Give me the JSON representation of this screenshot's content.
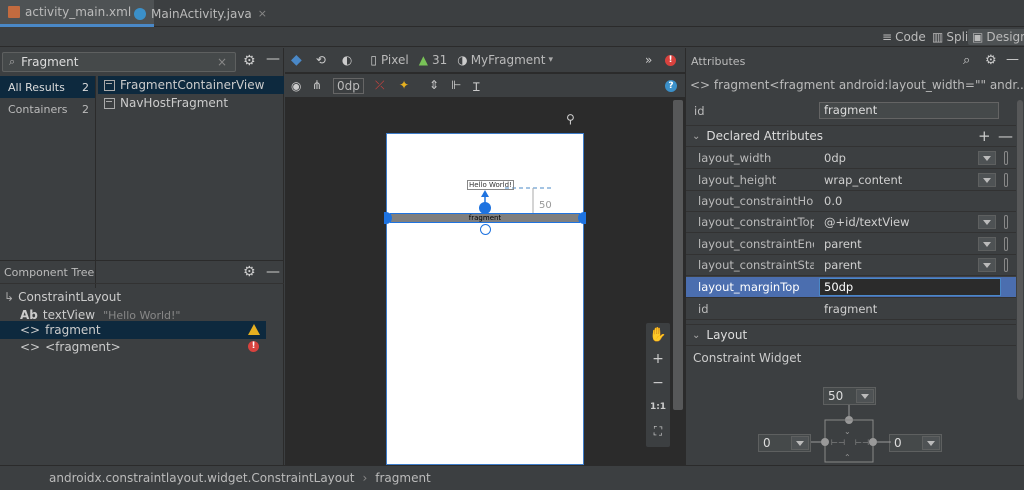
{
  "tabs": [
    {
      "label": "activity_main.xml",
      "close": "×"
    },
    {
      "label": "MainActivity.java",
      "close": "×"
    }
  ],
  "view_modes": {
    "code": "Code",
    "split": "Split",
    "design": "Design"
  },
  "palette": {
    "search_value": "Fragment",
    "categories": [
      {
        "label": "All Results",
        "count": "2"
      },
      {
        "label": "Containers",
        "count": "2"
      }
    ],
    "items": [
      "FragmentContainerView",
      "NavHostFragment"
    ]
  },
  "component_tree": {
    "title": "Component Tree",
    "rows": [
      {
        "label": "ConstraintLayout",
        "prefix": "",
        "hint": ""
      },
      {
        "label": "textView",
        "prefix": "Ab",
        "hint": "\"Hello World!\""
      },
      {
        "label": "fragment",
        "prefix": "<>",
        "hint": ""
      },
      {
        "label": "<fragment>",
        "prefix": "<>",
        "hint": ""
      }
    ]
  },
  "design_toolbar": {
    "device": "Pixel",
    "api": "31",
    "theme": "MyFragment",
    "margin": "0dp",
    "more": "»"
  },
  "canvas": {
    "textview_label": "Hello World!",
    "fragment_label": "fragment",
    "margin_label": "50"
  },
  "zoom_tools": {
    "plus": "+",
    "minus": "−",
    "ratio": "1:1"
  },
  "attributes": {
    "title": "Attributes",
    "tag_line": "<> fragment<fragment        android:layout_width=\"\"        andr...",
    "id_label": "id",
    "id_value": "fragment",
    "declared_header": "Declared Attributes",
    "rows": [
      {
        "key": "layout_width",
        "value": "0dp"
      },
      {
        "key": "layout_height",
        "value": "wrap_content"
      },
      {
        "key": "layout_constraintHorizo...",
        "value": "0.0"
      },
      {
        "key": "layout_constraintTop_to...",
        "value": "@+id/textView"
      },
      {
        "key": "layout_constraintEnd_toE...",
        "value": "parent"
      },
      {
        "key": "layout_constraintStart_to...",
        "value": "parent"
      },
      {
        "key": "layout_marginTop",
        "value": "50dp"
      },
      {
        "key": "id",
        "value": "fragment"
      }
    ],
    "layout_header": "Layout",
    "constraint_widget": "Constraint Widget",
    "top_margin": "50",
    "left_margin": "0",
    "right_margin": "0"
  },
  "footer": {
    "path": "androidx.constraintlayout.widget.ConstraintLayout",
    "sep": "›",
    "leaf": "fragment"
  },
  "colors": {
    "accent": "#4a88c7",
    "selection": "#0d293e",
    "selected_row": "#4b6eaf",
    "warning": "#e6b020",
    "error": "#d8423e"
  }
}
